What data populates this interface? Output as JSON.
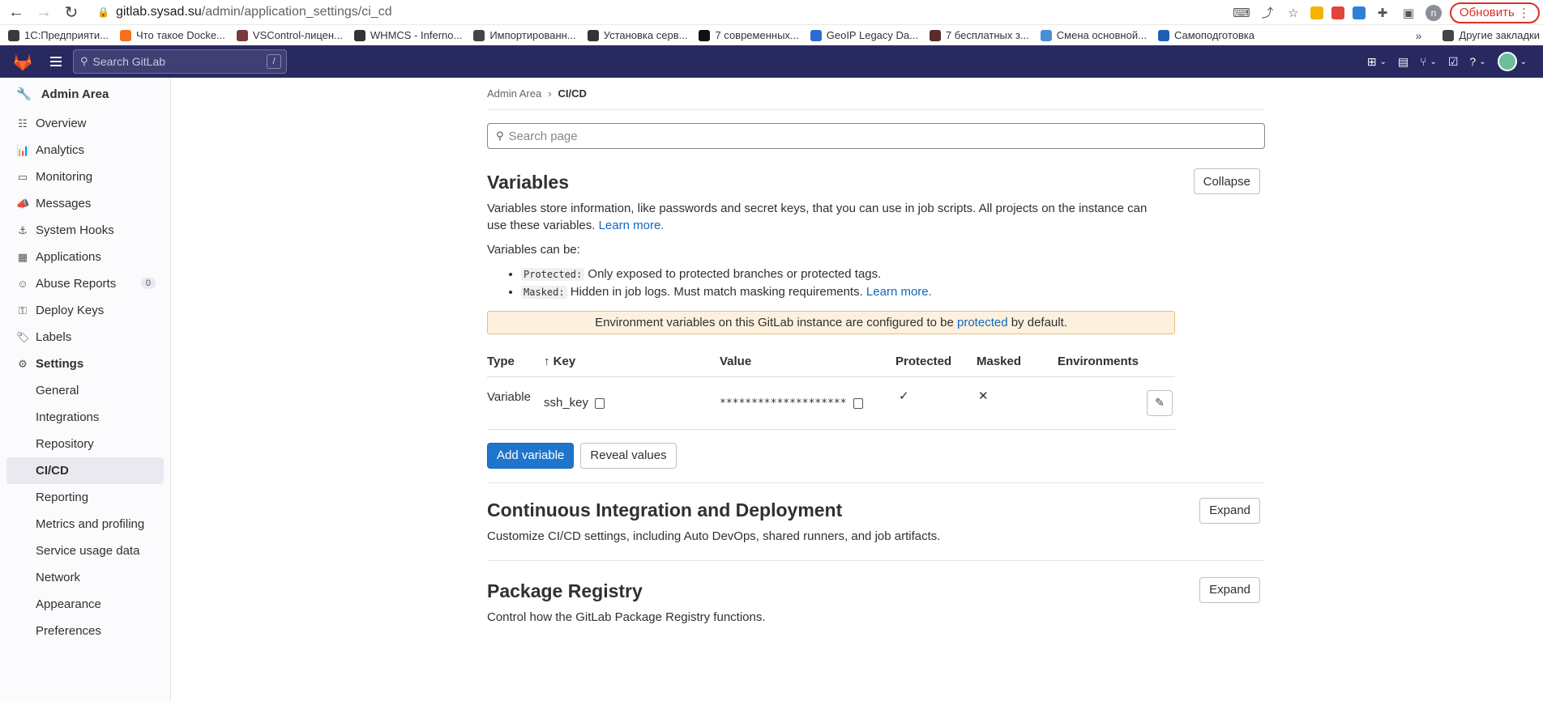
{
  "browser": {
    "url_host": "gitlab.sysad.su",
    "url_path": "/admin/application_settings/ci_cd",
    "profile_initial": "n",
    "update_label": "Обновить"
  },
  "bookmarks": [
    {
      "label": "1С:Предприяти...",
      "color": "#3a3a3a"
    },
    {
      "label": "Что такое Docke...",
      "color": "#f5701f"
    },
    {
      "label": "VSControl-лицен...",
      "color": "#7a3a3a"
    },
    {
      "label": "WHMCS - Inferno...",
      "color": "#333333"
    },
    {
      "label": "Импортированн...",
      "color": "#444444"
    },
    {
      "label": "Установка серв...",
      "color": "#333333"
    },
    {
      "label": "7 современных...",
      "color": "#111111"
    },
    {
      "label": "GeoIP Legacy Da...",
      "color": "#2d6ad6"
    },
    {
      "label": "7 бесплатных з...",
      "color": "#5a2b2b"
    },
    {
      "label": "Смена основной...",
      "color": "#4a8fd6"
    },
    {
      "label": "Самоподготовка",
      "color": "#1e5fb6"
    }
  ],
  "bookmarks_other": "Другие закладки",
  "topbar": {
    "search_placeholder": "Search GitLab",
    "search_shortcut": "/"
  },
  "sidebar": {
    "title": "Admin Area",
    "items": [
      {
        "label": "Overview",
        "icon": "overview-icon",
        "glyph": "☷"
      },
      {
        "label": "Analytics",
        "icon": "analytics-icon",
        "glyph": "📊"
      },
      {
        "label": "Monitoring",
        "icon": "monitoring-icon",
        "glyph": "▭"
      },
      {
        "label": "Messages",
        "icon": "messages-icon",
        "glyph": "📣"
      },
      {
        "label": "System Hooks",
        "icon": "hooks-icon",
        "glyph": "⚓"
      },
      {
        "label": "Applications",
        "icon": "applications-icon",
        "glyph": "▦"
      },
      {
        "label": "Abuse Reports",
        "icon": "abuse-icon",
        "glyph": "☺",
        "badge": "0"
      },
      {
        "label": "Deploy Keys",
        "icon": "key-icon",
        "glyph": "⚿"
      },
      {
        "label": "Labels",
        "icon": "label-icon",
        "glyph": "🏷"
      },
      {
        "label": "Settings",
        "icon": "settings-icon",
        "glyph": "⚙"
      }
    ],
    "sub_items": [
      "General",
      "Integrations",
      "Repository",
      "CI/CD",
      "Reporting",
      "Metrics and profiling",
      "Service usage data",
      "Network",
      "Appearance",
      "Preferences"
    ]
  },
  "breadcrumb": {
    "root": "Admin Area",
    "current": "CI/CD"
  },
  "page_search_placeholder": "Search page",
  "variables": {
    "title": "Variables",
    "collapse_label": "Collapse",
    "desc1": "Variables store information, like passwords and secret keys, that you can use in job scripts. All projects on the instance can use these variables.",
    "learn_more": "Learn more.",
    "can_be": "Variables can be:",
    "protected_code": "Protected:",
    "protected_text": "Only exposed to protected branches or protected tags.",
    "masked_code": "Masked:",
    "masked_text": "Hidden in job logs. Must match masking requirements.",
    "warn_prefix": "Environment variables on this GitLab instance are configured to be",
    "warn_link": "protected",
    "warn_suffix": "by default.",
    "headers": {
      "type": "Type",
      "key": "Key",
      "value": "Value",
      "protected": "Protected",
      "masked": "Masked",
      "environments": "Environments"
    },
    "row": {
      "type": "Variable",
      "key": "ssh_key",
      "value": "********************",
      "protected": "✓",
      "masked": "✕"
    },
    "add_label": "Add variable",
    "reveal_label": "Reveal values"
  },
  "cicd": {
    "title": "Continuous Integration and Deployment",
    "desc": "Customize CI/CD settings, including Auto DevOps, shared runners, and job artifacts.",
    "expand_label": "Expand"
  },
  "registry": {
    "title": "Package Registry",
    "desc": "Control how the GitLab Package Registry functions.",
    "expand_label": "Expand"
  }
}
